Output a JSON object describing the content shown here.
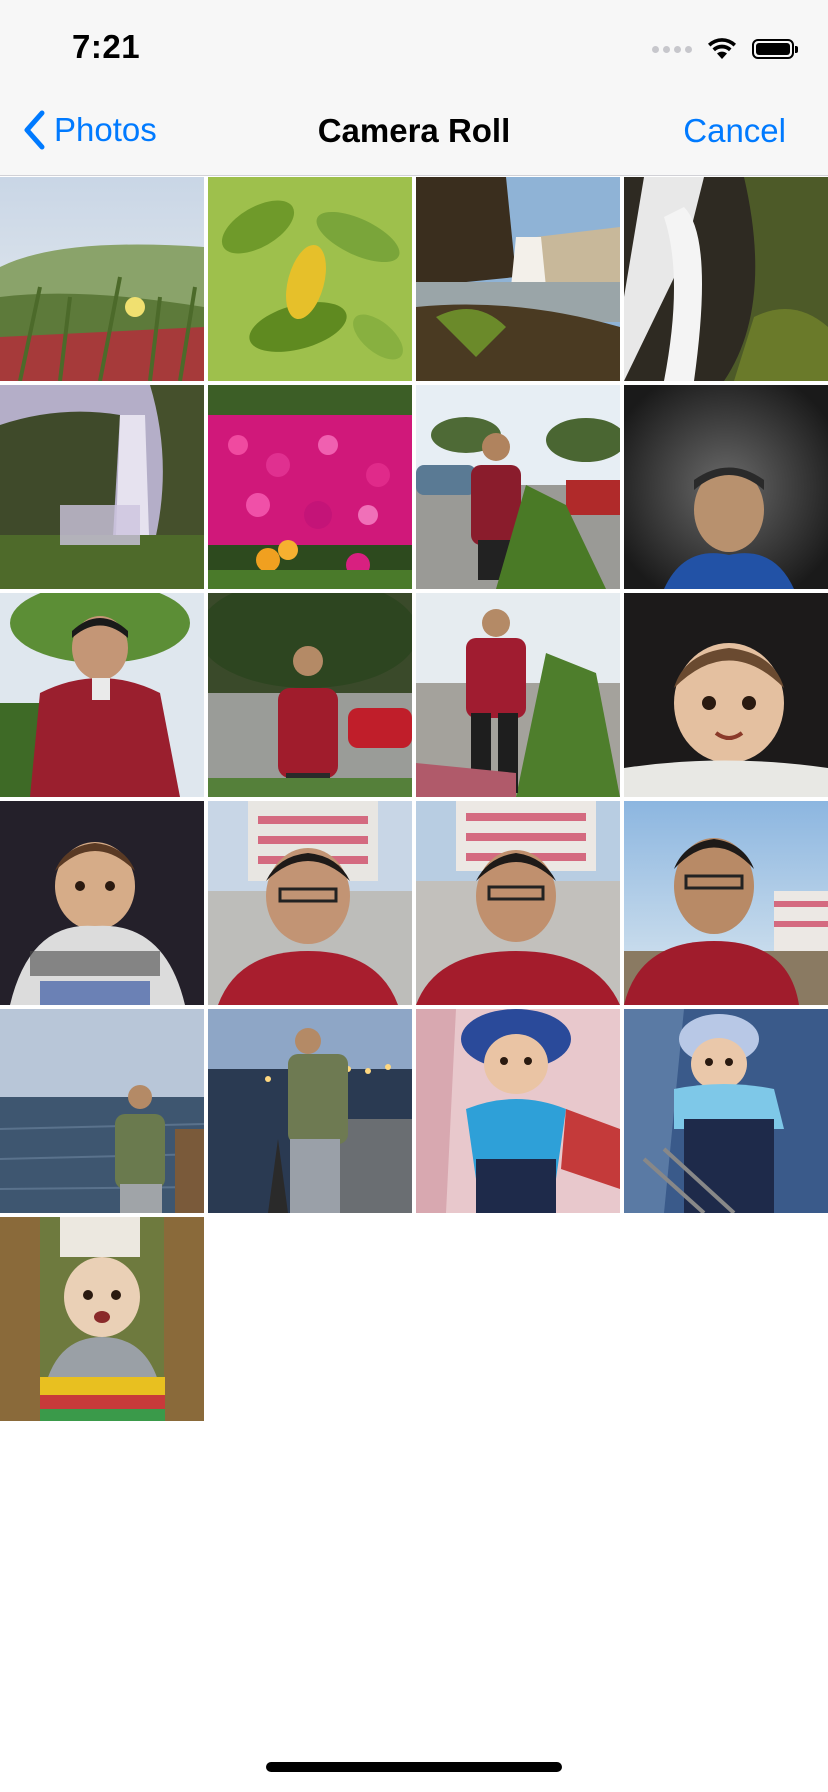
{
  "status_bar": {
    "time": "7:21"
  },
  "nav": {
    "back_label": "Photos",
    "title": "Camera Roll",
    "cancel_label": "Cancel"
  },
  "colors": {
    "accent": "#007aff"
  },
  "photos": [
    "flower-meadow",
    "green-leaves",
    "waterfall-cliff",
    "waterfall-rocks",
    "misty-waterfall",
    "pink-flowers",
    "man-by-tree",
    "man-night-selfie",
    "man-crouching",
    "man-by-car",
    "man-standing",
    "baby-portrait",
    "baby-sweater",
    "selfie-building-1",
    "selfie-building-2",
    "selfie-sky",
    "man-by-sea",
    "man-pier",
    "baby-hood",
    "baby-stroller",
    "baby-sitting"
  ]
}
